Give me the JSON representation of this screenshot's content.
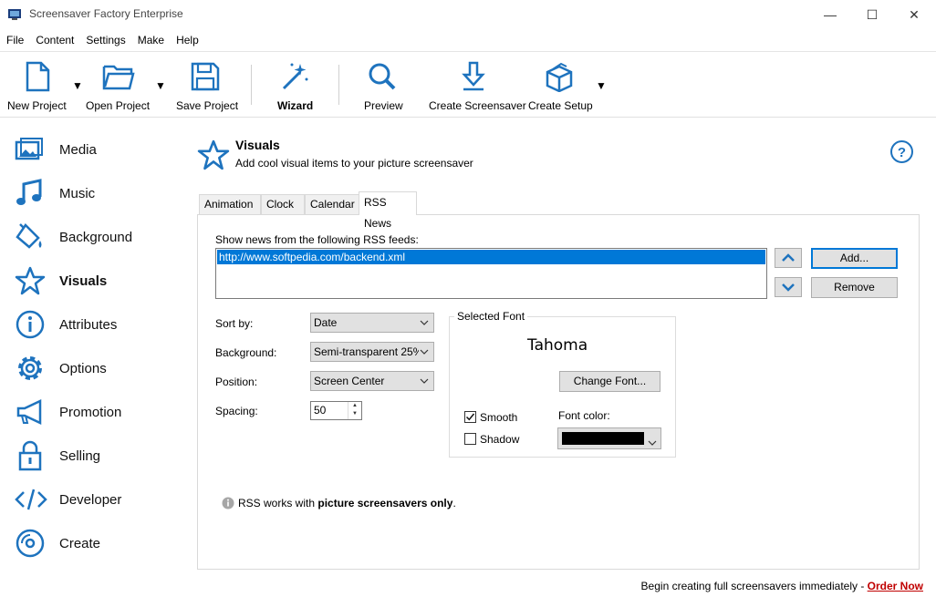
{
  "window": {
    "title": "Screensaver Factory Enterprise",
    "minimize_glyph": "—",
    "maximize_glyph": "☐",
    "close_glyph": "✕"
  },
  "menu": [
    "File",
    "Content",
    "Settings",
    "Make",
    "Help"
  ],
  "toolbar": {
    "new_project": "New Project",
    "open_project": "Open Project",
    "save_project": "Save Project",
    "wizard": "Wizard",
    "preview": "Preview",
    "create_screensaver": "Create Screensaver",
    "create_setup": "Create Setup",
    "dropdown_glyph": "▼"
  },
  "sidebar": {
    "items": [
      {
        "label": "Media",
        "icon": "image-icon"
      },
      {
        "label": "Music",
        "icon": "music-note-icon"
      },
      {
        "label": "Background",
        "icon": "paint-bucket-icon"
      },
      {
        "label": "Visuals",
        "icon": "star-icon"
      },
      {
        "label": "Attributes",
        "icon": "info-icon"
      },
      {
        "label": "Options",
        "icon": "gear-icon"
      },
      {
        "label": "Promotion",
        "icon": "megaphone-icon"
      },
      {
        "label": "Selling",
        "icon": "lock-icon"
      },
      {
        "label": "Developer",
        "icon": "code-icon"
      },
      {
        "label": "Create",
        "icon": "disc-icon"
      }
    ],
    "active": "Visuals"
  },
  "header": {
    "title": "Visuals",
    "subtitle": "Add cool visual items to your picture screensaver"
  },
  "tabs": [
    "Animation",
    "Clock",
    "Calendar",
    "RSS News"
  ],
  "active_tab": "RSS News",
  "rss": {
    "feeds_label": "Show news from the following RSS feeds:",
    "feeds": [
      "http://www.softpedia.com/backend.xml"
    ],
    "add_label": "Add...",
    "remove_label": "Remove"
  },
  "settings": {
    "sort_by_label": "Sort by:",
    "sort_by_value": "Date",
    "background_label": "Background:",
    "background_value": "Semi-transparent 25%",
    "position_label": "Position:",
    "position_value": "Screen Center",
    "spacing_label": "Spacing:",
    "spacing_value": "50"
  },
  "font": {
    "group_title": "Selected Font",
    "font_name": "Tahoma",
    "change_font_label": "Change Font...",
    "smooth_label": "Smooth",
    "smooth_checked": true,
    "shadow_label": "Shadow",
    "shadow_checked": false,
    "font_color_label": "Font color:",
    "font_color": "#000000"
  },
  "note": {
    "prefix": "RSS works with ",
    "bold": "picture screensavers only",
    "suffix": "."
  },
  "footer": {
    "text": "Begin creating full screensavers immediately - ",
    "link": "Order Now"
  },
  "colors": {
    "accent": "#0078d7",
    "icon_blue": "#1e73be",
    "link_red": "#c00000"
  }
}
